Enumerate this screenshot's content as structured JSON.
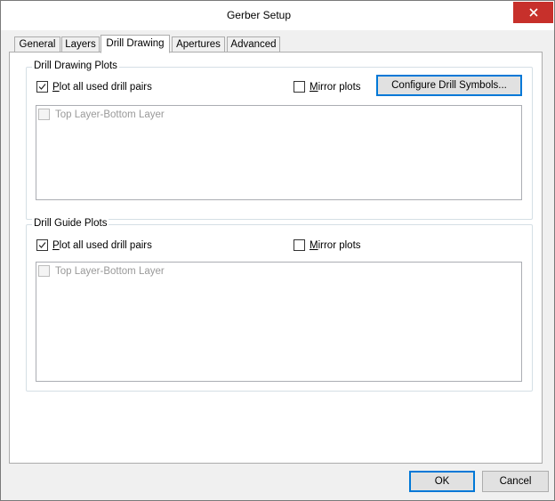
{
  "window": {
    "title": "Gerber Setup",
    "close_glyph": "✕"
  },
  "tabs": [
    {
      "label": "General"
    },
    {
      "label": "Layers"
    },
    {
      "label": "Drill Drawing",
      "active": true
    },
    {
      "label": "Apertures"
    },
    {
      "label": "Advanced"
    }
  ],
  "drill_drawing": {
    "title": "Drill Drawing Plots",
    "plot_all": {
      "label_first": "P",
      "label_rest": "lot all used drill pairs",
      "checked": true
    },
    "mirror": {
      "label_first": "M",
      "label_rest": "irror plots",
      "checked": false
    },
    "configure_button": "Configure Drill Symbols...",
    "list_items": [
      {
        "label": "Top Layer-Bottom Layer",
        "checked": false,
        "enabled": false
      }
    ]
  },
  "drill_guide": {
    "title": "Drill Guide Plots",
    "plot_all": {
      "label_first": "P",
      "label_rest": "lot all used drill pairs",
      "checked": true
    },
    "mirror": {
      "label_first": "M",
      "label_rest": "irror plots",
      "checked": false
    },
    "list_items": [
      {
        "label": "Top Layer-Bottom Layer",
        "checked": false,
        "enabled": false
      }
    ]
  },
  "footer": {
    "ok": "OK",
    "cancel": "Cancel"
  },
  "colors": {
    "close_red": "#c7302b",
    "accent_blue": "#0078d7",
    "disabled_text": "#9a9a9a"
  }
}
